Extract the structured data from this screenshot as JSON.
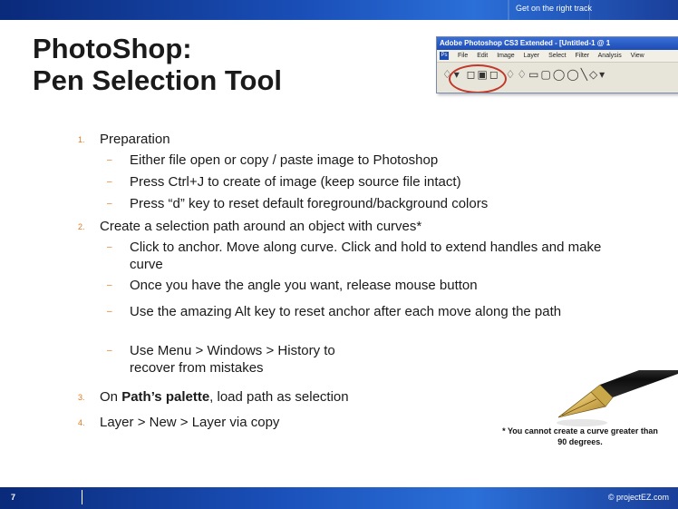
{
  "header": {
    "tagline": "Get on the right track"
  },
  "title": {
    "line1": "PhotoShop:",
    "line2": "Pen Selection Tool"
  },
  "ps_screenshot": {
    "titlebar": "Adobe Photoshop CS3 Extended - [Untitled-1 @ 1",
    "badge": "Ps",
    "menu": [
      "File",
      "Edit",
      "Image",
      "Layer",
      "Select",
      "Filter",
      "Analysis",
      "View"
    ],
    "options_glyphs": "♢▾ ◻▣◻ ♢♢▭▢◯◯╲◇▾"
  },
  "steps": [
    {
      "num": "1.",
      "text": "Preparation",
      "subs": [
        "Either file open or copy / paste image to Photoshop",
        "Press Ctrl+J to create of image (keep source file intact)",
        "Press “d” key to reset default foreground/background colors"
      ]
    },
    {
      "num": "2.",
      "text": "Create a selection path around an object with curves*",
      "subs": [
        "Click to anchor.  Move along curve. Click and hold to extend handles and make curve",
        "Once you have the angle you want, release mouse button",
        "Use the amazing Alt key to reset anchor after each move along the path",
        "Use Menu > Windows > History to recover from mistakes"
      ]
    },
    {
      "num": "3.",
      "text_prefix": "On ",
      "text_bold": "Path’s palette",
      "text_suffix": ", load path as selection"
    },
    {
      "num": "4.",
      "text": "Layer > New > Layer via copy"
    }
  ],
  "note": {
    "line1": "* You cannot create a curve greater than",
    "line2": "90 degrees."
  },
  "footer": {
    "page_number": "7",
    "copyright": "© projectEZ.com"
  },
  "colors": {
    "bar_blue": "#1a4fb8",
    "bullet_orange": "#e07a1f",
    "highlight_red": "#c0392b"
  }
}
